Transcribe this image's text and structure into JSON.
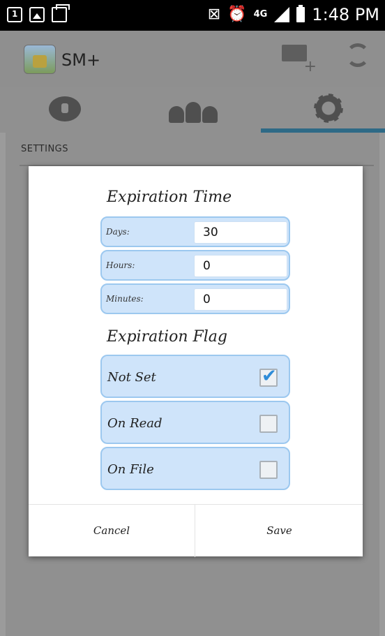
{
  "status_bar": {
    "time": "1:48 PM",
    "network": "4G",
    "icons": [
      "notification-1-icon",
      "image-icon",
      "cards-icon",
      "nfc-icon",
      "alarm-icon",
      "network-4g-icon",
      "signal-icon",
      "battery-icon"
    ]
  },
  "app_bar": {
    "title": "SM+",
    "actions": [
      "compose-mail-icon",
      "refresh-icon"
    ]
  },
  "tabs": [
    {
      "icon": "message-lock-icon",
      "active": false
    },
    {
      "icon": "contacts-icon",
      "active": false
    },
    {
      "icon": "settings-gear-icon",
      "active": true
    }
  ],
  "section": {
    "header": "SETTINGS"
  },
  "dialog": {
    "expiration_time_title": "Expiration Time",
    "fields": [
      {
        "label": "Days:",
        "value": "30"
      },
      {
        "label": "Hours:",
        "value": "0"
      },
      {
        "label": "Minutes:",
        "value": "0"
      }
    ],
    "expiration_flag_title": "Expiration Flag",
    "flags": [
      {
        "label": "Not Set",
        "checked": true
      },
      {
        "label": "On Read",
        "checked": false
      },
      {
        "label": "On File",
        "checked": false
      }
    ],
    "buttons": {
      "cancel": "Cancel",
      "save": "Save"
    }
  },
  "colors": {
    "accent": "#2e6a86",
    "row_fill": "#cfe4fa",
    "row_border": "#9cc8ef",
    "check": "#2f8cd8"
  }
}
